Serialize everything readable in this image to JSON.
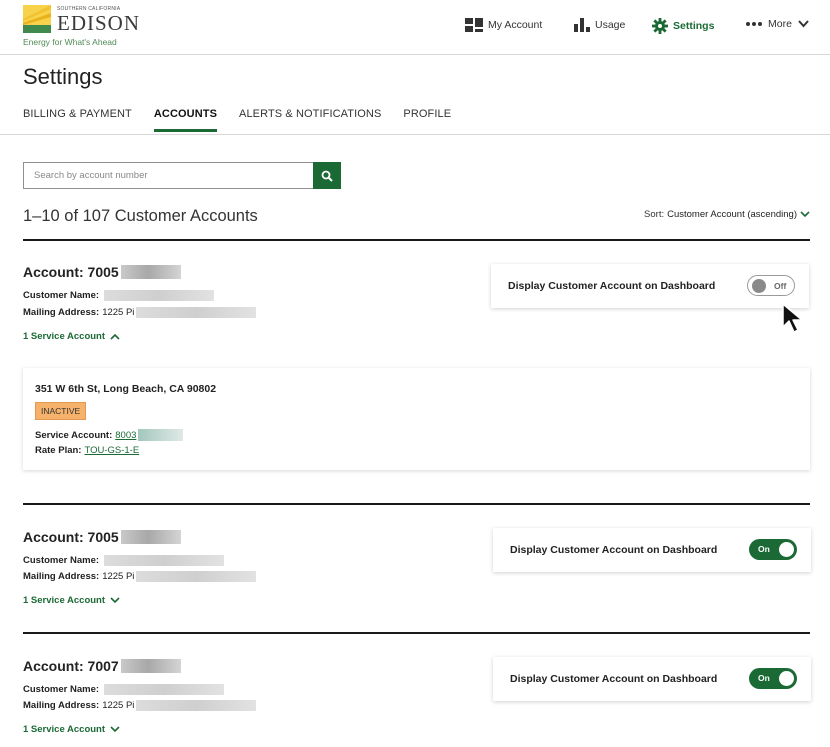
{
  "brand": {
    "small_text": "SOUTHERN CALIFORNIA",
    "name": "EDISON",
    "tagline": "Energy for What's Ahead",
    "colors": {
      "primary_green": "#1b6a35",
      "logo_yellow": "#f2c230",
      "badge_orange": "#f6b26b"
    }
  },
  "nav": {
    "my_account": {
      "label": "My Account",
      "icon": "dashboard-icon"
    },
    "usage": {
      "label": "Usage",
      "icon": "bar-chart-icon"
    },
    "settings": {
      "label": "Settings",
      "icon": "gear-icon"
    },
    "more": {
      "label": "More",
      "icon": "more-dots-icon"
    }
  },
  "page": {
    "title": "Settings",
    "tabs": [
      {
        "label": "BILLING & PAYMENT",
        "active": false
      },
      {
        "label": "ACCOUNTS",
        "active": true
      },
      {
        "label": "ALERTS & NOTIFICATIONS",
        "active": false
      },
      {
        "label": "PROFILE",
        "active": false
      }
    ]
  },
  "search": {
    "placeholder": "Search by account number",
    "value": ""
  },
  "results": {
    "summary": "1–10 of 107 Customer Accounts",
    "sort_label": "Sort:",
    "sort_value": "Customer Account (ascending)"
  },
  "labels": {
    "customer_name": "Customer Name:",
    "mailing_address": "Mailing Address:",
    "service_account": "Service Account:",
    "rate_plan": "Rate Plan:",
    "display_toggle": "Display Customer Account on Dashboard"
  },
  "accounts": [
    {
      "title": "Account: 7005",
      "mailing_address_partial": "1225 Pi",
      "service_accounts_label": "1 Service Account",
      "expanded": true,
      "dashboard_toggle": "Off",
      "service": {
        "address": "351 W 6th St, Long Beach, CA 90802",
        "status": "INACTIVE",
        "service_account_partial": "8003",
        "rate_plan": "TOU-GS-1-E"
      }
    },
    {
      "title": "Account: 7005",
      "mailing_address_partial": "1225 Pi",
      "service_accounts_label": "1 Service Account",
      "expanded": false,
      "dashboard_toggle": "On"
    },
    {
      "title": "Account: 7007",
      "mailing_address_partial": "1225 Pi",
      "service_accounts_label": "1 Service Account",
      "expanded": false,
      "dashboard_toggle": "On"
    }
  ]
}
